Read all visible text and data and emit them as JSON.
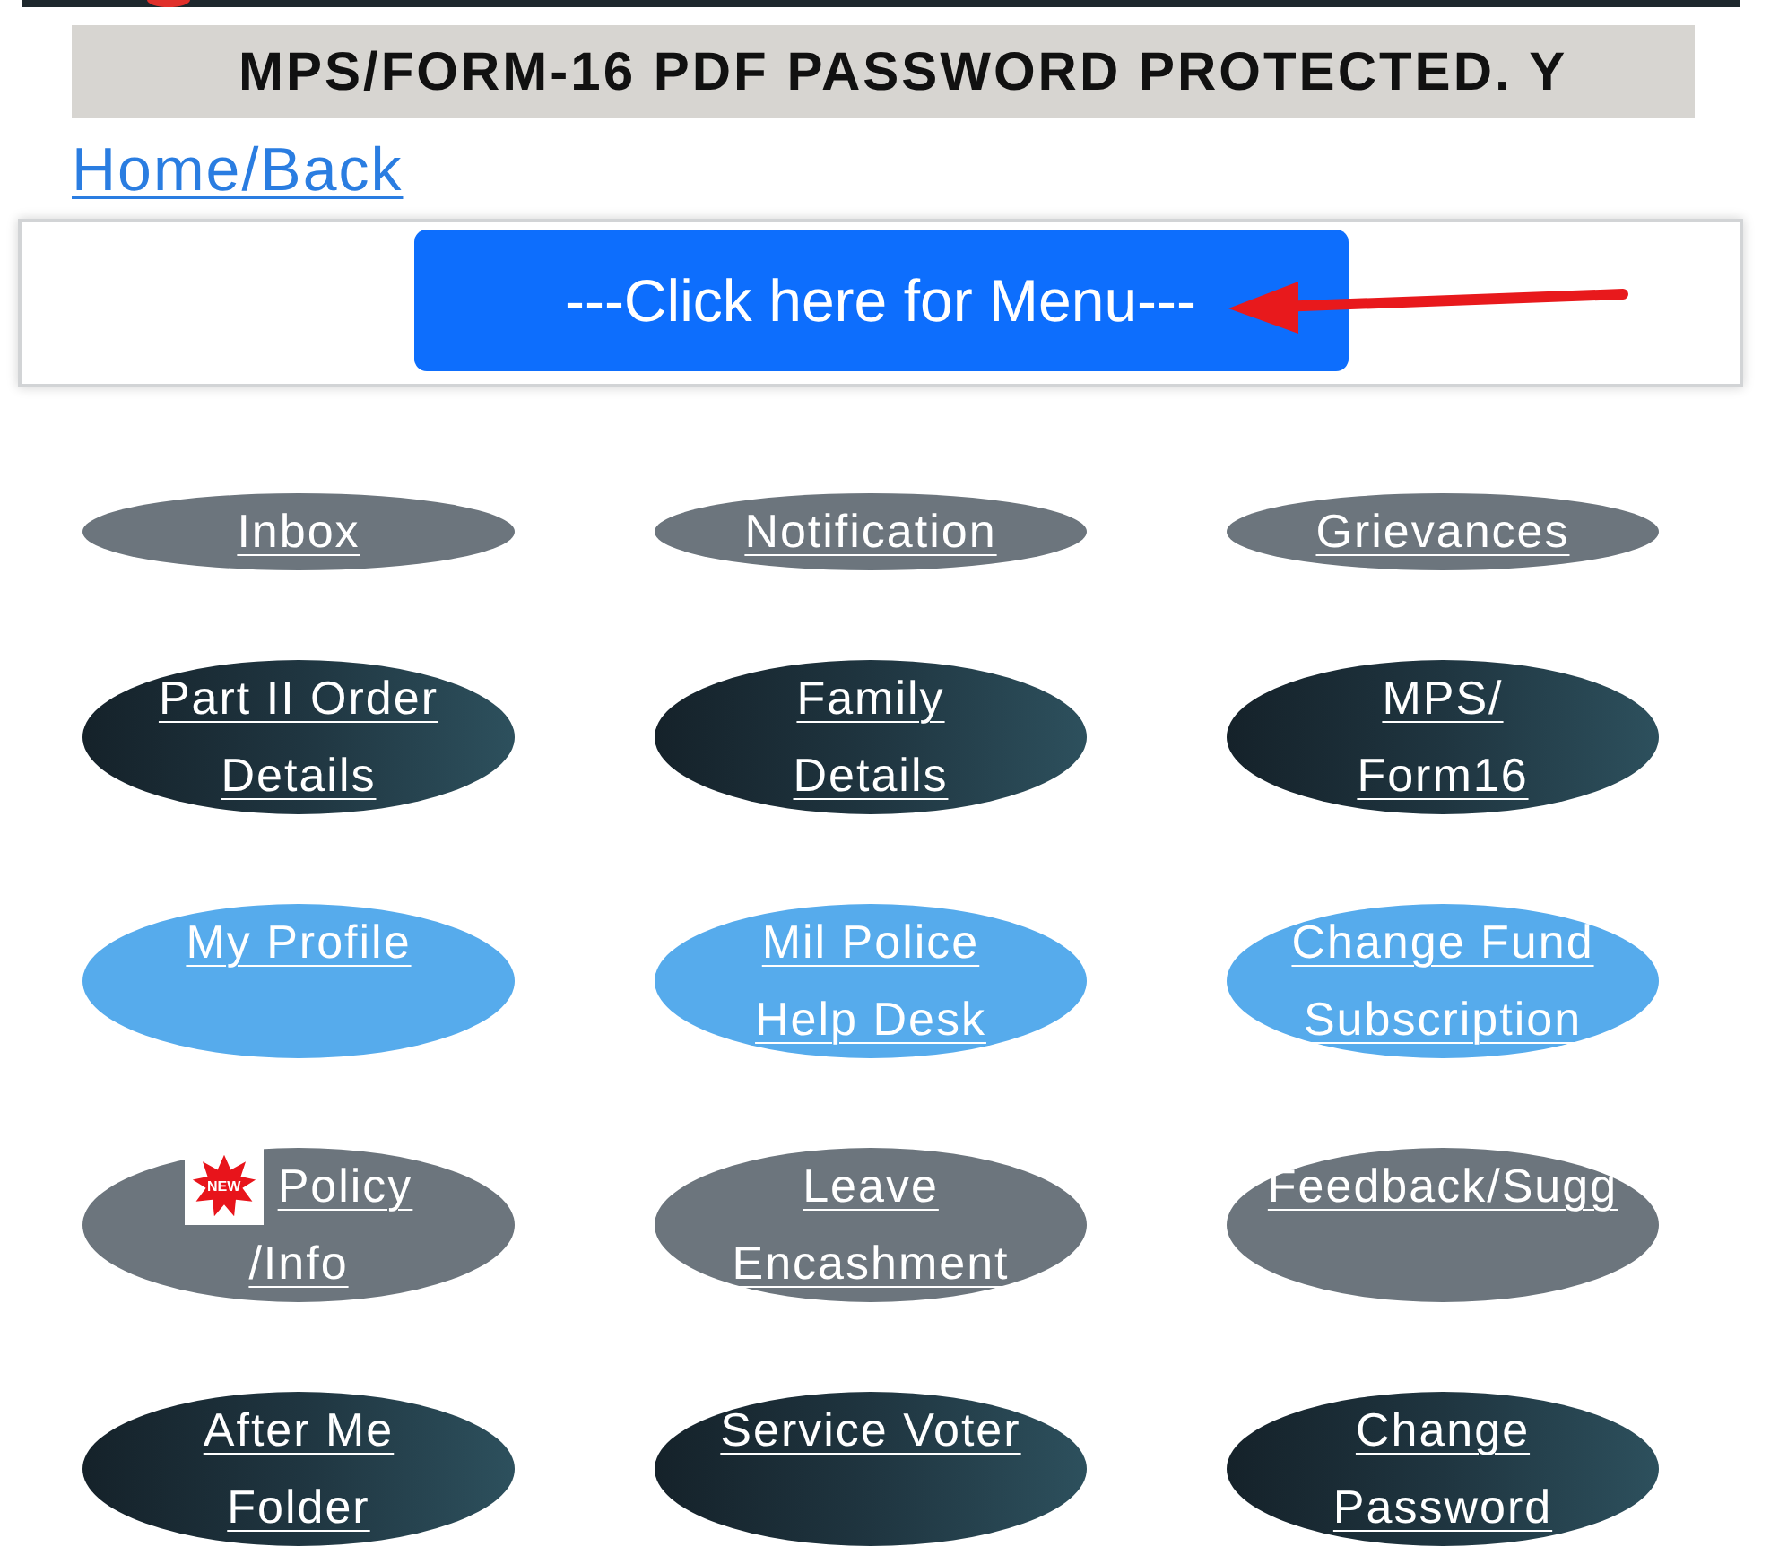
{
  "banner": {
    "text": "MPS/FORM-16 PDF PASSWORD PROTECTED. Y"
  },
  "home_link": "Home/Back",
  "menu_button": {
    "label": "---Click here for Menu---"
  },
  "tiles": [
    {
      "lines": [
        "Inbox"
      ],
      "kind": "secondary"
    },
    {
      "lines": [
        "Notification"
      ],
      "kind": "secondary"
    },
    {
      "lines": [
        "Grievances"
      ],
      "kind": "secondary"
    },
    {
      "lines": [
        "Part II Order",
        "Details"
      ],
      "kind": "dark"
    },
    {
      "lines": [
        "Family",
        "Details"
      ],
      "kind": "dark"
    },
    {
      "lines": [
        "MPS/",
        "Form16"
      ],
      "kind": "dark"
    },
    {
      "lines": [
        "My Profile"
      ],
      "kind": "info"
    },
    {
      "lines": [
        "Mil Police",
        "Help Desk"
      ],
      "kind": "info"
    },
    {
      "lines": [
        "Change Fund",
        "Subscription"
      ],
      "kind": "info"
    },
    {
      "lines": [
        "Policy",
        "/Info"
      ],
      "kind": "secondary",
      "badge": "NEW"
    },
    {
      "lines": [
        "Leave",
        "Encashment"
      ],
      "kind": "secondary"
    },
    {
      "lines": [
        "Feedback/Sugg"
      ],
      "kind": "secondary"
    },
    {
      "lines": [
        "After Me",
        "Folder"
      ],
      "kind": "dark"
    },
    {
      "lines": [
        "Service Voter"
      ],
      "kind": "dark"
    },
    {
      "lines": [
        "Change",
        "Password"
      ],
      "kind": "dark"
    }
  ]
}
